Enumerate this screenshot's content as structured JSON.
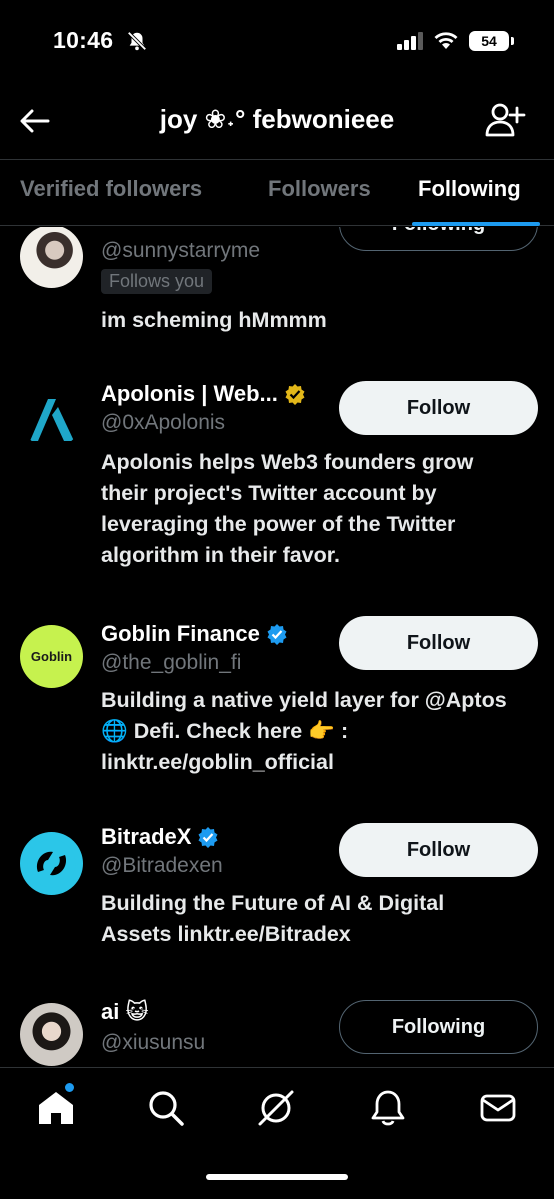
{
  "status_bar": {
    "time": "10:46",
    "battery": "54"
  },
  "header": {
    "title": "joy ❀˖° febwonieee"
  },
  "tabs": [
    {
      "label": "Verified followers"
    },
    {
      "label": "Followers"
    },
    {
      "label": "Following",
      "active": true
    }
  ],
  "users": [
    {
      "name": "",
      "handle": "@sunnystarryme",
      "follows_you": "Follows you",
      "bio": "im scheming hMmmm",
      "button": "Following",
      "verified": ""
    },
    {
      "name": "Apolonis | Web...",
      "handle": "@0xApolonis",
      "bio": "Apolonis helps Web3 founders grow their project's Twitter account by leveraging the power of the Twitter algorithm in their favor.",
      "button": "Follow",
      "verified": "gold"
    },
    {
      "name": "Goblin Finance",
      "handle": "@the_goblin_fi",
      "bio": "Building a native yield layer for @Aptos 🌐 Defi. Check here 👉 : linktr.ee/goblin_official",
      "button": "Follow",
      "verified": "blue",
      "avatar_text": "Goblin"
    },
    {
      "name": "BitradeX",
      "handle": "@Bitradexen",
      "bio": "Building the Future of AI & Digital Assets linktr.ee/Bitradex",
      "button": "Follow",
      "verified": "blue"
    },
    {
      "name": "ai 😺",
      "handle": "@xiusunsu",
      "bio": "",
      "button": "Following",
      "verified": ""
    }
  ],
  "nav": {
    "items": [
      "home-icon",
      "search-icon",
      "grok-icon",
      "notifications-icon",
      "messages-icon"
    ]
  },
  "colors": {
    "accent": "#1d9bf0",
    "background": "#000000",
    "muted": "#71767b",
    "gold_badge": "#e2b719"
  }
}
